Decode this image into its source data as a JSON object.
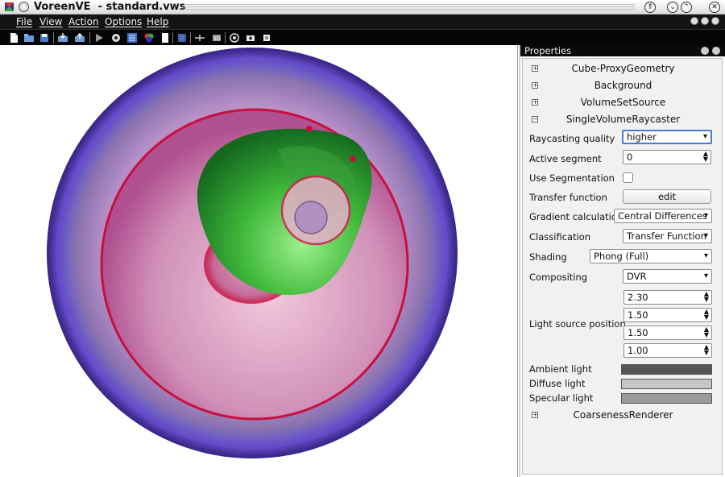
{
  "window": {
    "title": "VoreenVE  - standard.vws"
  },
  "menubar": {
    "items": [
      "File",
      "View",
      "Action",
      "Options",
      "Help"
    ]
  },
  "toolbar": {
    "icons": [
      "new-icon",
      "open-icon",
      "save-icon",
      "import-icon",
      "export-icon",
      "run-icon",
      "settings-icon",
      "network-icon",
      "color-icon",
      "page-icon",
      "grid-icon",
      "layout-icon",
      "render-icon",
      "camera-icon",
      "snapshot-icon",
      "script-icon"
    ]
  },
  "properties": {
    "header": "Properties",
    "sections": [
      {
        "label": "Cube-ProxyGeometry",
        "expanded": false
      },
      {
        "label": "Background",
        "expanded": false
      },
      {
        "label": "VolumeSetSource",
        "expanded": false
      },
      {
        "label": "SingleVolumeRaycaster",
        "expanded": true
      },
      {
        "label": "CoarsenessRenderer",
        "expanded": false
      }
    ],
    "raycaster": {
      "raycasting_quality_label": "Raycasting quality",
      "raycasting_quality_value": "higher",
      "active_segment_label": "Active segment",
      "active_segment_value": "0",
      "use_segmentation_label": "Use Segmentation",
      "transfer_function_label": "Transfer function",
      "transfer_function_button": "edit",
      "gradient_calculation_label": "Gradient calculation",
      "gradient_calculation_value": "Central Differences",
      "classification_label": "Classification",
      "classification_value": "Transfer Function",
      "shading_label": "Shading",
      "shading_value": "Phong (Full)",
      "compositing_label": "Compositing",
      "compositing_value": "DVR",
      "light_source_position_label": "Light source position",
      "light_x": "2.30",
      "light_y": "1.50",
      "light_z": "1.50",
      "light_w": "1.00",
      "ambient_light_label": "Ambient light",
      "diffuse_light_label": "Diffuse light",
      "specular_light_label": "Specular light"
    },
    "colors": {
      "ambient": "#555555",
      "diffuse": "#c6c6c6",
      "specular": "#9a9a9a"
    }
  }
}
